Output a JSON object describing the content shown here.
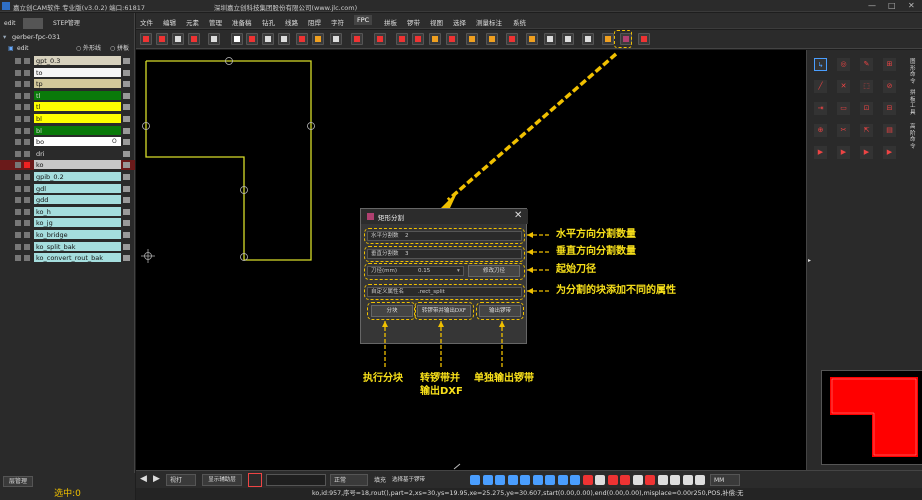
{
  "app": {
    "title": "嘉立创CAM软件 专业版(v3.0.2) 端口:61817",
    "company": "深圳嘉立创科技集团股份有限公司(www.jlc.com)"
  },
  "left_panel": {
    "tabs": [
      "edit",
      "STEP管理"
    ],
    "file_name": "gerber-fpc-031",
    "edit_label": "edit",
    "option1": "外形线",
    "option2": "拼板",
    "layers": [
      {
        "name": "gpt_0.3",
        "color": "#d8d2be",
        "mark": ""
      },
      {
        "name": "to",
        "color": "#f5f5f5",
        "mark": ""
      },
      {
        "name": "tp",
        "color": "#d2c89b",
        "mark": ""
      },
      {
        "name": "tl",
        "color": "#0a7a0a",
        "mark": ""
      },
      {
        "name": "tl",
        "color": "#ffff00",
        "mark": ""
      },
      {
        "name": "bl",
        "color": "#ffff00",
        "mark": ""
      },
      {
        "name": "bl",
        "color": "#0a7a0a",
        "mark": ""
      },
      {
        "name": "bo",
        "color": "#ffffff",
        "mark": "O"
      },
      {
        "name": "dri",
        "color": "#2a2a2a",
        "mark": ""
      },
      {
        "name": "ko",
        "color": "#c8c8c8",
        "mark": ""
      },
      {
        "name": "gpib_0.2",
        "color": "#a5dede",
        "mark": ""
      },
      {
        "name": "gdl",
        "color": "#a5dede",
        "mark": ""
      },
      {
        "name": "gdd",
        "color": "#a5dede",
        "mark": ""
      },
      {
        "name": "ko_h",
        "color": "#a5dede",
        "mark": ""
      },
      {
        "name": "ko_jg",
        "color": "#a5dede",
        "mark": ""
      },
      {
        "name": "ko_bridge",
        "color": "#a5dede",
        "mark": ""
      },
      {
        "name": "ko_split_bak",
        "color": "#a5dede",
        "mark": ""
      },
      {
        "name": "ko_convert_rout_bak",
        "color": "#a5dede",
        "mark": ""
      }
    ],
    "layer_manager": "层管理",
    "selected_count": "选中:0"
  },
  "menu": [
    "文件",
    "编辑",
    "元素",
    "管理",
    "准备稿",
    "钻孔",
    "线路",
    "阻焊",
    "字符",
    "FPC",
    "拼板",
    "锣带",
    "视图",
    "选择",
    "测量标注",
    "系统"
  ],
  "menu_active": "FPC",
  "dialog": {
    "title": "矩形分割",
    "h_label": "水平分割数",
    "h_value": "2",
    "v_label": "垂直分割数",
    "v_value": "3",
    "tool_label": "刀径(mm)",
    "tool_value": "0.15",
    "modify_btn": "修改刀径",
    "attr_label": "自定义属性名",
    "attr_value": ".rect_split",
    "btn_split": "分块",
    "btn_convert": "转锣带并输出DXF",
    "btn_output": "输出锣带"
  },
  "annotations": {
    "h": "水平方向分割数量",
    "v": "垂直方向分割数量",
    "tool": "起始刀径",
    "attr": "为分割的块添加不同的属性",
    "split": "执行分块",
    "convert_line1": "转锣带并",
    "convert_line2": "输出DXF",
    "output": "单独输出锣带"
  },
  "right_panel": {
    "side_labels": [
      "图形命令",
      "拼板工具",
      "高阶命令"
    ]
  },
  "bottom": {
    "zoom": "视打",
    "display_btn": "显示辅助层",
    "mode": "正常",
    "fill_label": "填充",
    "select_label": "选择基于锣带",
    "unit": "MM",
    "status": "ko,id:957,序号=18,rout(),part=2,xs=30,ys=19.95,xe=25.275,ye=30.607,start(0.00,0.00),end(0.00,0.00),misplace=0.00r250,POS,补偿:无"
  },
  "colors": {
    "accent": "#f0c000",
    "red_shape": "#ff0000",
    "outline": "#c8d22a"
  }
}
